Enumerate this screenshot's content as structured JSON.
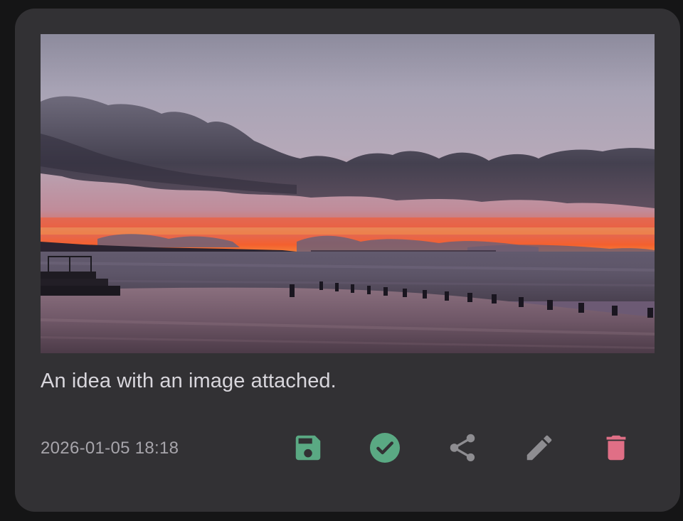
{
  "card": {
    "text": "An idea with an image attached.",
    "timestamp": "2026-01-05 18:18",
    "image_subject": "sunset over the sea with a pier and wooden posts"
  },
  "actions": [
    {
      "icon": "save-icon",
      "color": "#5aa983"
    },
    {
      "icon": "check-circle-icon",
      "color": "#5aa983"
    },
    {
      "icon": "share-icon",
      "color": "#8e8d91"
    },
    {
      "icon": "pencil-icon",
      "color": "#8e8d91"
    },
    {
      "icon": "trash-icon",
      "color": "#e06f86"
    }
  ],
  "colors": {
    "page_background": "#151516",
    "card_background": "#323134",
    "accent_green": "#5aa983",
    "accent_red": "#e06f86",
    "neutral_icon": "#8e8d91"
  }
}
